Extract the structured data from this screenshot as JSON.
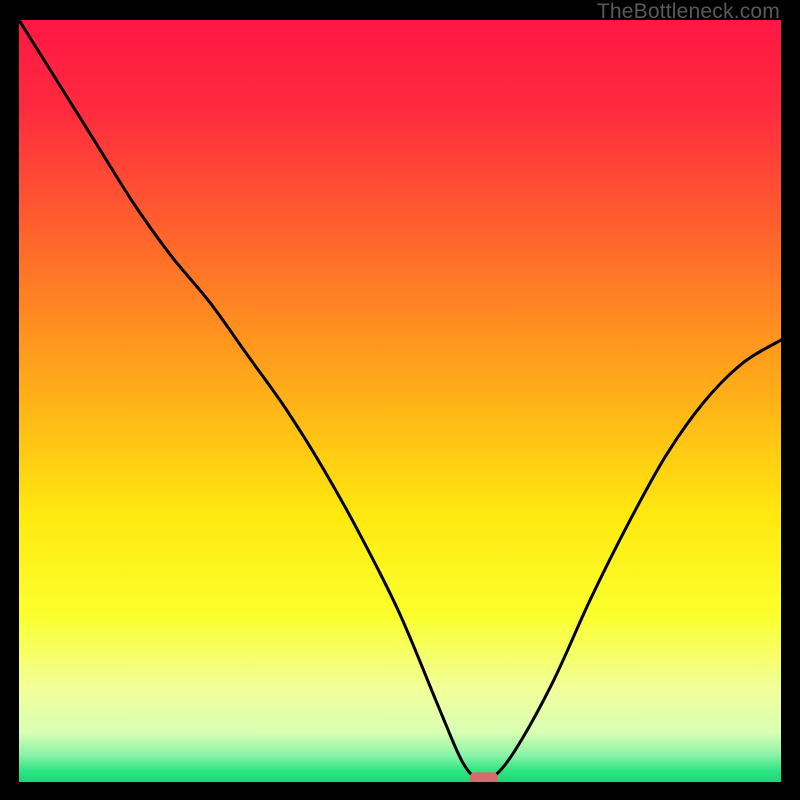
{
  "watermark": "TheBottleneck.com",
  "chart_data": {
    "type": "line",
    "title": "",
    "xlabel": "",
    "ylabel": "",
    "xlim": [
      0,
      100
    ],
    "ylim": [
      0,
      100
    ],
    "x": [
      0,
      5,
      10,
      15,
      20,
      25,
      30,
      35,
      40,
      45,
      50,
      55,
      58,
      60,
      62,
      65,
      70,
      75,
      80,
      85,
      90,
      95,
      100
    ],
    "y": [
      100,
      92,
      84,
      76,
      69,
      63,
      56,
      49,
      41,
      32,
      22,
      10,
      3,
      0.5,
      0.5,
      4,
      13,
      24,
      34,
      43,
      50,
      55,
      58
    ],
    "min_marker": {
      "x": 61,
      "y": 0.5
    },
    "gradient_stops": [
      {
        "offset": 0.0,
        "color": "#ff1744"
      },
      {
        "offset": 0.12,
        "color": "#ff2b3e"
      },
      {
        "offset": 0.3,
        "color": "#ff6a2a"
      },
      {
        "offset": 0.5,
        "color": "#ffb217"
      },
      {
        "offset": 0.65,
        "color": "#ffe90f"
      },
      {
        "offset": 0.78,
        "color": "#fbff2c"
      },
      {
        "offset": 0.88,
        "color": "#f1ff9c"
      },
      {
        "offset": 0.935,
        "color": "#d8ffb3"
      },
      {
        "offset": 0.965,
        "color": "#88f3a6"
      },
      {
        "offset": 0.985,
        "color": "#2fe582"
      },
      {
        "offset": 1.0,
        "color": "#15d977"
      }
    ]
  }
}
